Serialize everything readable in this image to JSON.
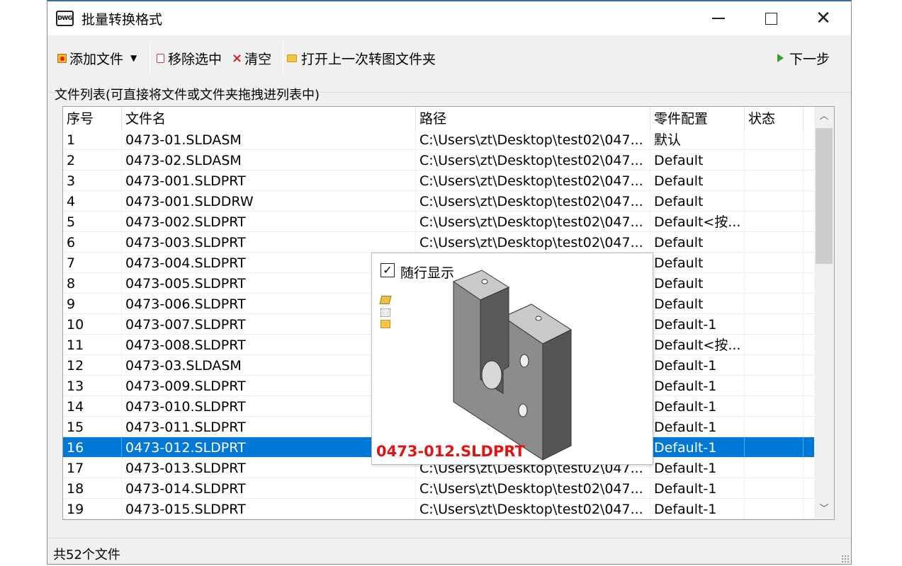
{
  "window": {
    "title": "批量转换格式",
    "icon_label": "DWG",
    "icon": "dwg-file-icon"
  },
  "toolbar": {
    "add_files": "添加文件",
    "remove_selected": "移除选中",
    "clear": "清空",
    "open_last_folder": "打开上一次转图文件夹",
    "next_step": "下一步"
  },
  "list_caption": "文件列表(可直接将文件或文件夹拖拽进列表中)",
  "table": {
    "columns": [
      "序号",
      "文件名",
      "路径",
      "零件配置",
      "状态"
    ],
    "rows": [
      {
        "no": "1",
        "name": "0473-01.SLDASM",
        "path": "C:\\Users\\zt\\Desktop\\test02\\047...",
        "config": "默认",
        "status": ""
      },
      {
        "no": "2",
        "name": "0473-02.SLDASM",
        "path": "C:\\Users\\zt\\Desktop\\test02\\047...",
        "config": "Default",
        "status": ""
      },
      {
        "no": "3",
        "name": "0473-001.SLDPRT",
        "path": "C:\\Users\\zt\\Desktop\\test02\\047...",
        "config": "Default",
        "status": ""
      },
      {
        "no": "4",
        "name": "0473-001.SLDDRW",
        "path": "C:\\Users\\zt\\Desktop\\test02\\047...",
        "config": "Default",
        "status": ""
      },
      {
        "no": "5",
        "name": "0473-002.SLDPRT",
        "path": "C:\\Users\\zt\\Desktop\\test02\\047...",
        "config": "Default<按...",
        "status": ""
      },
      {
        "no": "6",
        "name": "0473-003.SLDPRT",
        "path": "C:\\Users\\zt\\Desktop\\test02\\047...",
        "config": "Default",
        "status": ""
      },
      {
        "no": "7",
        "name": "0473-004.SLDPRT",
        "path": "",
        "config": "Default",
        "status": ""
      },
      {
        "no": "8",
        "name": "0473-005.SLDPRT",
        "path": "",
        "config": "Default",
        "status": ""
      },
      {
        "no": "9",
        "name": "0473-006.SLDPRT",
        "path": "",
        "config": "Default",
        "status": ""
      },
      {
        "no": "10",
        "name": "0473-007.SLDPRT",
        "path": "",
        "config": "Default-1",
        "status": ""
      },
      {
        "no": "11",
        "name": "0473-008.SLDPRT",
        "path": "",
        "config": "Default<按...",
        "status": ""
      },
      {
        "no": "12",
        "name": "0473-03.SLDASM",
        "path": "",
        "config": "Default-1",
        "status": ""
      },
      {
        "no": "13",
        "name": "0473-009.SLDPRT",
        "path": "",
        "config": "Default-1",
        "status": ""
      },
      {
        "no": "14",
        "name": "0473-010.SLDPRT",
        "path": "",
        "config": "Default-1",
        "status": ""
      },
      {
        "no": "15",
        "name": "0473-011.SLDPRT",
        "path": "",
        "config": "Default-1",
        "status": ""
      },
      {
        "no": "16",
        "name": "0473-012.SLDPRT",
        "path": "",
        "config": "Default-1",
        "status": "",
        "selected": true
      },
      {
        "no": "17",
        "name": "0473-013.SLDPRT",
        "path": "C:\\Users\\zt\\Desktop\\test02\\047...",
        "config": "Default-1",
        "status": ""
      },
      {
        "no": "18",
        "name": "0473-014.SLDPRT",
        "path": "C:\\Users\\zt\\Desktop\\test02\\047...",
        "config": "Default-1",
        "status": ""
      },
      {
        "no": "19",
        "name": "0473-015.SLDPRT",
        "path": "C:\\Users\\zt\\Desktop\\test02\\047...",
        "config": "Default-1",
        "status": ""
      }
    ]
  },
  "preview": {
    "follow_checkbox_label": "随行显示",
    "follow_checked": true,
    "file_caption": "0473-012.SLDPRT",
    "caption_color": "#e01414"
  },
  "status_bar": {
    "text": "共52个文件"
  },
  "colors": {
    "selection": "#0078d7",
    "next_arrow": "#2aa52a",
    "clear_x": "#d61f1f"
  }
}
